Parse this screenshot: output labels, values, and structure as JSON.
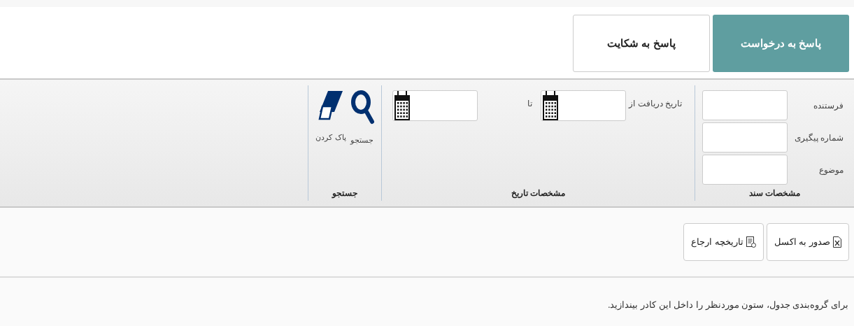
{
  "tabs": [
    {
      "label": "پاسخ به درخواست",
      "selected": true
    },
    {
      "label": "پاسخ به شکایت",
      "selected": false
    }
  ],
  "ribbon": {
    "document_group": {
      "title": "مشخصات سند",
      "fields": [
        {
          "label": "فرستنده"
        },
        {
          "label": "شماره پیگیری"
        },
        {
          "label": "موضوع"
        }
      ]
    },
    "date_group": {
      "title": "مشخصات تاریخ",
      "from_label": "تاریخ دریافت از",
      "to_label": "تا"
    },
    "search_group": {
      "title": "جستجو",
      "actions": [
        {
          "kind": "search",
          "label": "جستجو"
        },
        {
          "kind": "clear",
          "label": "پاک کردن"
        }
      ]
    }
  },
  "toolbar": [
    {
      "kind": "excel",
      "label": "صدور به اکسل"
    },
    {
      "kind": "history",
      "label": "تاریخچه ارجاع"
    }
  ],
  "group_panel": {
    "hint": "برای گروه‌بندی جدول، ستون موردنظر را داخل این کادر بیندازید."
  }
}
